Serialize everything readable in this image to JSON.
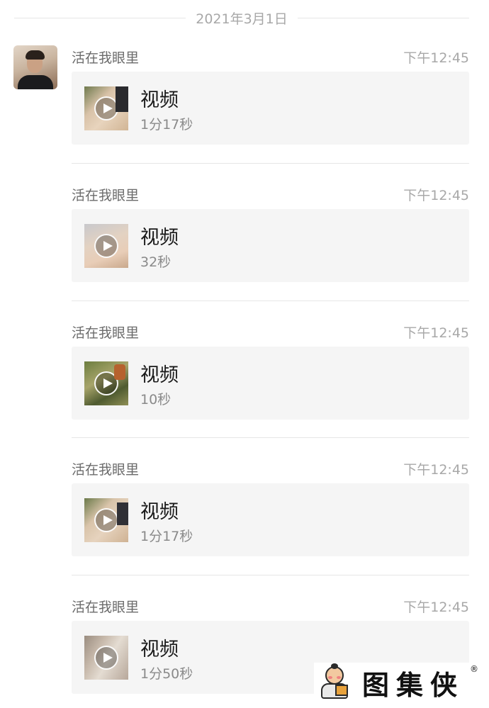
{
  "date_separator": "2021年3月1日",
  "messages": [
    {
      "sender": "活在我眼里",
      "time": "下午12:45",
      "title": "视频",
      "duration": "1分17秒",
      "icon": "video-thumbnail"
    },
    {
      "sender": "活在我眼里",
      "time": "下午12:45",
      "title": "视频",
      "duration": "32秒",
      "icon": "video-thumbnail"
    },
    {
      "sender": "活在我眼里",
      "time": "下午12:45",
      "title": "视频",
      "duration": "10秒",
      "icon": "video-thumbnail"
    },
    {
      "sender": "活在我眼里",
      "time": "下午12:45",
      "title": "视频",
      "duration": "1分17秒",
      "icon": "video-thumbnail"
    },
    {
      "sender": "活在我眼里",
      "time": "下午12:45",
      "title": "视频",
      "duration": "1分50秒",
      "icon": "video-thumbnail"
    }
  ],
  "watermark": {
    "text": "图集侠",
    "registered": "®"
  },
  "colors": {
    "card_bg": "#f5f5f5",
    "muted_text": "#a8a8a8",
    "sender_text": "#6b6b6b"
  }
}
